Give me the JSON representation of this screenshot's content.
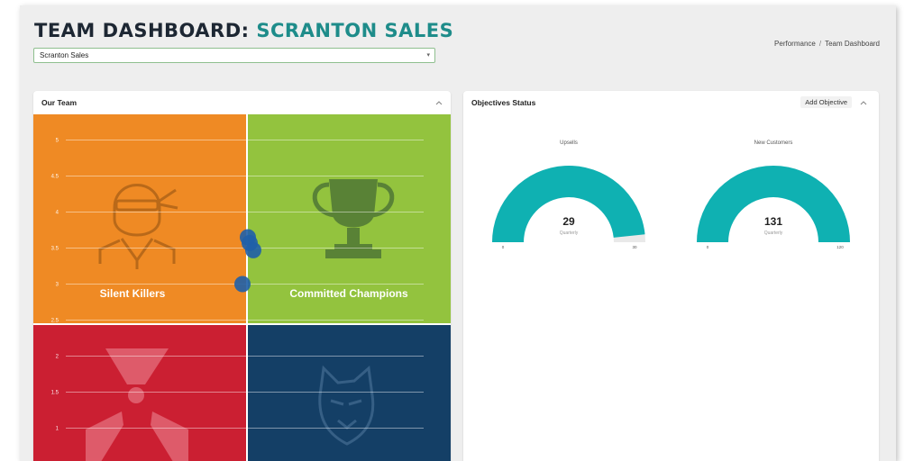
{
  "header": {
    "title_prefix": "TEAM DASHBOARD: ",
    "title_team": "SCRANTON SALES",
    "breadcrumb": [
      "Performance",
      "Team Dashboard"
    ],
    "breadcrumb_sep": "/"
  },
  "team_select": {
    "value": "Scranton Sales",
    "caret": "▾"
  },
  "team_panel": {
    "title": "Our Team",
    "collapse_icon": "chevron-up",
    "quadrants": [
      {
        "label": "Silent Killers",
        "color": "#ef8a24",
        "icon": "ninja-icon"
      },
      {
        "label": "Committed Champions",
        "color": "#93c33e",
        "icon": "trophy-icon"
      },
      {
        "label": "",
        "color": "#cb1f32",
        "icon": "radiation-icon"
      },
      {
        "label": "",
        "color": "#143f66",
        "icon": "wolf-icon"
      }
    ],
    "y_ticks": [
      "5",
      "4.5",
      "4",
      "3.5",
      "3",
      "2.5",
      "2",
      "1.5",
      "1"
    ],
    "ylim": [
      1,
      5
    ]
  },
  "objectives_panel": {
    "title": "Objectives Status",
    "add_button": "Add Objective",
    "collapse_icon": "chevron-up",
    "gauge_color": "#0fb1b2",
    "gauges": [
      {
        "title": "Upsells",
        "value": "29",
        "period": "Quarterly",
        "min": "0",
        "max": "30",
        "fraction": 0.967
      },
      {
        "title": "New Customers",
        "value": "131",
        "period": "Quarterly",
        "min": "0",
        "max": "120",
        "fraction": 1.0
      }
    ]
  },
  "chart_data": {
    "type": "scatter",
    "y_ticks": [
      5,
      4.5,
      4,
      3.5,
      3,
      2.5,
      2,
      1.5,
      1
    ],
    "ylim": [
      1,
      5
    ],
    "points": [
      {
        "x": 0,
        "y": 3.65
      },
      {
        "x": 0.1,
        "y": 3.57
      },
      {
        "x": 0.3,
        "y": 3.47
      },
      {
        "x": -0.3,
        "y": 3.0
      }
    ],
    "point_color": "#1f5fa8"
  }
}
